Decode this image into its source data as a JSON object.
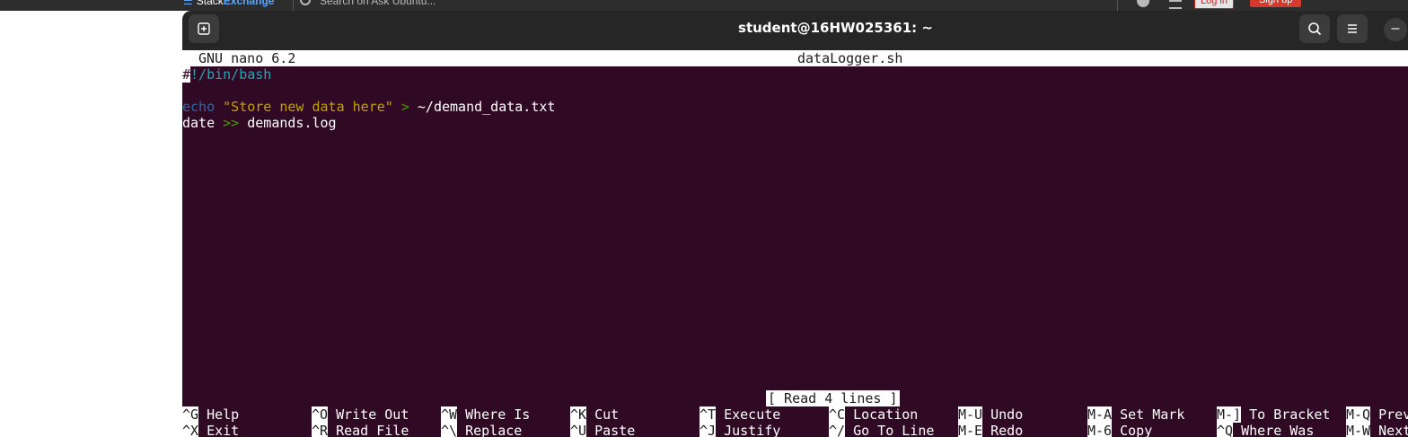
{
  "background": {
    "brand_prefix": "Stack",
    "brand_suffix": "Exchange",
    "search_placeholder": "Search on Ask Ubuntu...",
    "login_label": "Log in",
    "signup_label": "Sign up"
  },
  "terminal": {
    "title": "student@16HW025361: ~",
    "min_glyph": "–"
  },
  "nano": {
    "version": "GNU nano 6.2",
    "filename": "dataLogger.sh",
    "lines": {
      "l1_cursor": "#",
      "l1_rest": "!/bin/bash",
      "l3_kw": "echo",
      "l3_str": "\"Store new data here\"",
      "l3_op": ">",
      "l3_rest": "~/demand_data.txt",
      "l4_cmd": "date",
      "l4_op": ">>",
      "l4_rest": "demands.log"
    },
    "status": "[ Read 4 lines ]",
    "shortcuts_row1": [
      {
        "key": "^G",
        "label": "Help"
      },
      {
        "key": "^O",
        "label": "Write Out"
      },
      {
        "key": "^W",
        "label": "Where Is"
      },
      {
        "key": "^K",
        "label": "Cut"
      },
      {
        "key": "^T",
        "label": "Execute"
      },
      {
        "key": "^C",
        "label": "Location"
      },
      {
        "key": "M-U",
        "label": "Undo"
      },
      {
        "key": "M-A",
        "label": "Set Mark"
      },
      {
        "key": "M-]",
        "label": "To Bracket"
      },
      {
        "key": "M-Q",
        "label": "Previous"
      }
    ],
    "shortcuts_row2": [
      {
        "key": "^X",
        "label": "Exit"
      },
      {
        "key": "^R",
        "label": "Read File"
      },
      {
        "key": "^\\",
        "label": "Replace"
      },
      {
        "key": "^U",
        "label": "Paste"
      },
      {
        "key": "^J",
        "label": "Justify"
      },
      {
        "key": "^/",
        "label": "Go To Line"
      },
      {
        "key": "M-E",
        "label": "Redo"
      },
      {
        "key": "M-6",
        "label": "Copy"
      },
      {
        "key": "^Q",
        "label": "Where Was"
      },
      {
        "key": "M-W",
        "label": "Next"
      }
    ]
  },
  "colors": {
    "terminal_bg": "#300a24",
    "titlebar_bg": "#262626",
    "shebang": "#2aa1b3",
    "keyword": "#3465a4",
    "string": "#c4a000",
    "operator": "#4e9a06"
  },
  "icons": {
    "new_tab": "new-tab-icon",
    "search": "search-icon",
    "menu": "hamburger-menu-icon",
    "minimize": "minimize-icon"
  }
}
